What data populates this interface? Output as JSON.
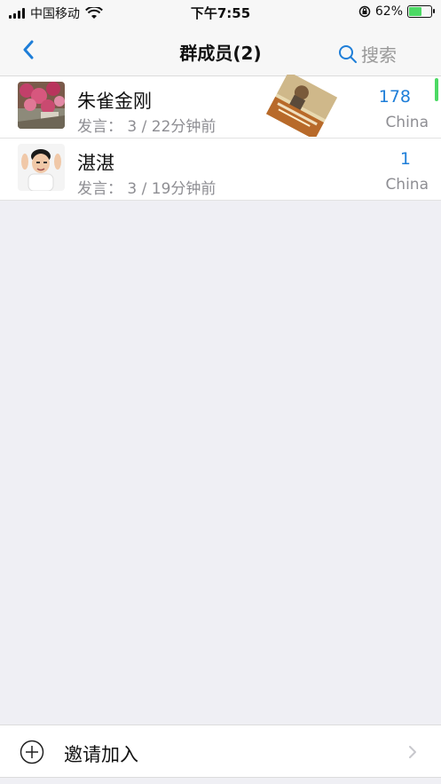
{
  "status_bar": {
    "carrier": "中国移动",
    "time": "下午7:55",
    "battery_percent": "62%",
    "battery_level": 0.62,
    "icons": [
      "signal-icon",
      "wifi-icon",
      "rotation-lock-icon",
      "battery-charging-icon"
    ]
  },
  "nav": {
    "back_icon": "chevron-left-icon",
    "title": "群成员(2)",
    "search_label": "搜索",
    "search_icon": "search-icon",
    "accent_color": "#1e7ed8"
  },
  "members": [
    {
      "name": "朱雀金刚",
      "sub": "发言： 3 / 22分钟前",
      "count": "178",
      "country": "China"
    },
    {
      "name": "湛湛",
      "sub": "发言： 3 / 19分钟前",
      "count": "1",
      "country": "China"
    }
  ],
  "invite": {
    "label": "邀请加入",
    "icon": "plus-circle-icon",
    "chevron": "chevron-right-icon"
  }
}
